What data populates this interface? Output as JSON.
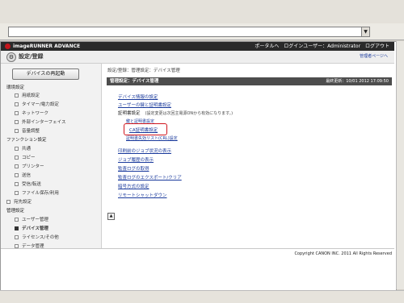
{
  "app": {
    "name": "imageRUNNER ADVANCE",
    "header_links": [
      "ポータルへ",
      "ログインユーザー：Administrator",
      "ログアウト"
    ],
    "title": "設定/登録",
    "portal_link": "管理者ページへ"
  },
  "sidebar": {
    "restart_button": "デバイスの再起動",
    "sections": [
      {
        "title": "環境設定",
        "items": [
          "用紙設定",
          "タイマー/電力設定",
          "ネットワーク",
          "外部インターフェイス",
          "音量調整"
        ]
      },
      {
        "title": "ファンクション設定",
        "items": [
          "共通",
          "コピー",
          "プリンター",
          "送信",
          "受信/転送",
          "ファイル保存/利用"
        ]
      },
      {
        "title": "宛先設定",
        "items": []
      },
      {
        "title": "管理設定",
        "items": [
          "ユーザー管理",
          "デバイス管理",
          "ライセンス/その他",
          "データ管理"
        ]
      }
    ],
    "active_item": "デバイス管理"
  },
  "main": {
    "breadcrumb": "設定/登録：管理設定：デバイス管理",
    "section_title": "管理設定：デバイス管理",
    "last_updated": "最終更新：10/01 2012 17:09:50",
    "links": [
      "デバイス情報の設定",
      "ユーザーの鍵と証明書設定",
      "証明書設定",
      "鍵と証明書設定",
      "CA証明書設定",
      "証明書失効リスト(CRL)設定",
      "印刷前のジョブ状況の表示",
      "ジョブ履歴の表示",
      "監査ログの取得",
      "監査ログのエクスポート/クリア",
      "暗号方式の設定",
      "リモートシャットダウン"
    ],
    "cert_note": "(設定変更は次回主電源ONから有効になります。)",
    "highlighted": "CA証明書設定"
  },
  "footer": {
    "copyright": "Copyright CANON INC. 2011 All Rights Reserved"
  },
  "colors": {
    "header_bg": "#2a2a2a",
    "section_bar": "#4d4d4d",
    "link": "#1a3a9c",
    "highlight": "#d0141c"
  }
}
